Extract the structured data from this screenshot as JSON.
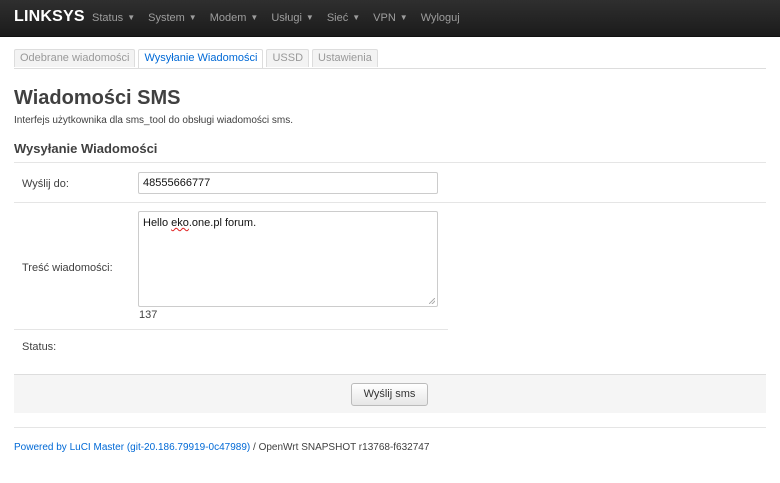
{
  "brand": "LINKSYS",
  "nav": [
    {
      "label": "Status",
      "dropdown": true
    },
    {
      "label": "System",
      "dropdown": true
    },
    {
      "label": "Modem",
      "dropdown": true
    },
    {
      "label": "Usługi",
      "dropdown": true
    },
    {
      "label": "Sieć",
      "dropdown": true
    },
    {
      "label": "VPN",
      "dropdown": true
    },
    {
      "label": "Wyloguj",
      "dropdown": false
    }
  ],
  "tabs": [
    {
      "label": "Odebrane wiadomości",
      "active": false
    },
    {
      "label": "Wysyłanie Wiadomości",
      "active": true
    },
    {
      "label": "USSD",
      "active": false
    },
    {
      "label": "Ustawienia",
      "active": false
    }
  ],
  "page": {
    "title": "Wiadomości SMS",
    "description": "Interfejs użytkownika dla sms_tool do obsługi wiadomości sms."
  },
  "section": {
    "title": "Wysyłanie Wiadomości"
  },
  "form": {
    "recipient_label": "Wyślij do:",
    "recipient_value": "48555666777",
    "message_label": "Treść wiadomości:",
    "message_before": "Hello ",
    "message_misspelled": "eko",
    "message_after": ".one.pl forum.",
    "char_count": "137",
    "status_label": "Status:",
    "send_label": "Wyślij sms"
  },
  "footer": {
    "link_text": "Powered by LuCI Master (git-20.186.79919-0c47989)",
    "rest_text": " / OpenWrt SNAPSHOT r13768-f632747"
  },
  "colors": {
    "navbar": "#222222",
    "link": "#0069d6",
    "spellcheck": "#e02020"
  }
}
